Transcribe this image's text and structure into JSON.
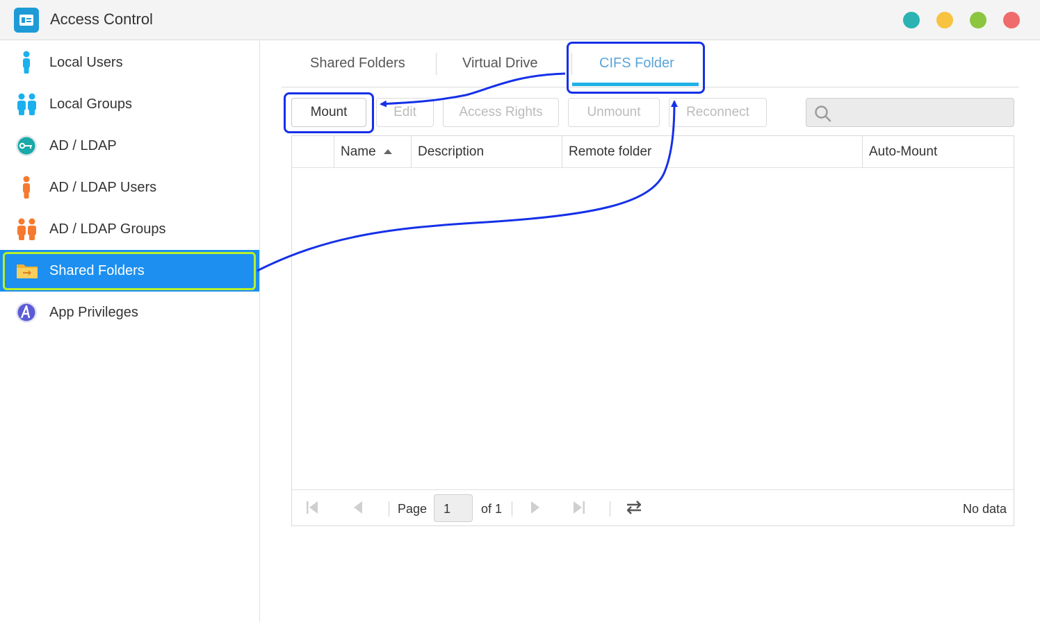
{
  "window": {
    "title": "Access Control",
    "controls": [
      {
        "name": "control-teal",
        "color": "#2bb3b3"
      },
      {
        "name": "control-yellow",
        "color": "#f7c340"
      },
      {
        "name": "control-green",
        "color": "#8cc63f"
      },
      {
        "name": "control-red",
        "color": "#f06b6b"
      }
    ]
  },
  "sidebar": {
    "items": [
      {
        "label": "Local Users",
        "icon": "person-icon"
      },
      {
        "label": "Local Groups",
        "icon": "group-icon"
      },
      {
        "label": "AD / LDAP",
        "icon": "key-icon"
      },
      {
        "label": "AD / LDAP Users",
        "icon": "person-icon"
      },
      {
        "label": "AD / LDAP Groups",
        "icon": "group-icon"
      },
      {
        "label": "Shared Folders",
        "icon": "folder-icon",
        "active": true
      },
      {
        "label": "App Privileges",
        "icon": "app-icon"
      }
    ]
  },
  "tabs": [
    {
      "label": "Shared Folders"
    },
    {
      "label": "Virtual Drive"
    },
    {
      "label": "CIFS Folder",
      "active": true
    }
  ],
  "toolbar": {
    "mount": "Mount",
    "edit": "Edit",
    "access_rights": "Access Rights",
    "unmount": "Unmount",
    "reconnect": "Reconnect",
    "search_placeholder": ""
  },
  "table": {
    "columns": [
      "Name",
      "Description",
      "Remote folder",
      "Auto-Mount"
    ],
    "rows": []
  },
  "pager": {
    "page_label": "Page",
    "page_value": "1",
    "of_label": "of 1",
    "status": "No data"
  },
  "colors": {
    "accent": "#1c8ff0",
    "tab_active": "#5aa4d8",
    "annotation": "#1530e8",
    "highlight": "#b9f02a"
  }
}
